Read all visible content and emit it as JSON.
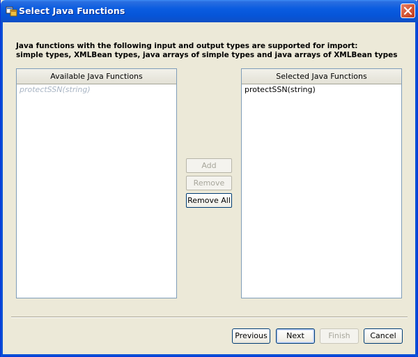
{
  "window": {
    "title": "Select Java Functions"
  },
  "description": {
    "line1": "Java functions with the following input and output types are supported for import:",
    "line2": "simple types, XMLBean types, java arrays of simple types and java arrays of XMLBean types"
  },
  "available": {
    "header": "Available Java Functions",
    "items": [
      "protectSSN(string)"
    ]
  },
  "selected": {
    "header": "Selected Java Functions",
    "items": [
      "protectSSN(string)"
    ]
  },
  "transfer_buttons": {
    "add": "Add",
    "remove": "Remove",
    "remove_all": "Remove All"
  },
  "footer_buttons": {
    "previous": "Previous",
    "next": "Next",
    "finish": "Finish",
    "cancel": "Cancel"
  },
  "colors": {
    "titlebar": "#0a5ce0",
    "dialog_bg": "#ece9d8",
    "disabled_text": "#a9b5c4"
  }
}
